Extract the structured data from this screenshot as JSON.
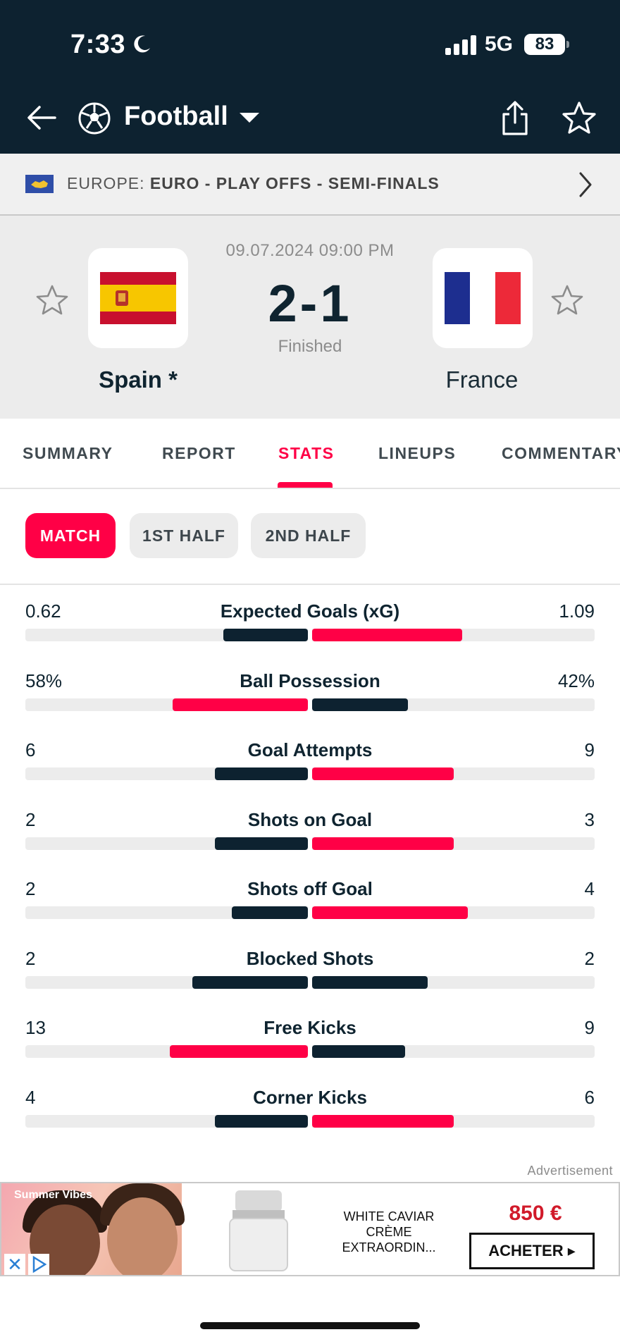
{
  "status_bar": {
    "time": "7:33",
    "network": "5G",
    "battery": "83"
  },
  "header": {
    "sport": "Football"
  },
  "league": {
    "region": "EUROPE:",
    "competition": "EURO - PLAY OFFS - SEMI-FINALS"
  },
  "match": {
    "date": "09.07.2024 09:00 PM",
    "score": "2-1",
    "status": "Finished",
    "home": {
      "name": "Spain *"
    },
    "away": {
      "name": "France"
    }
  },
  "tabs": [
    {
      "label": "SUMMARY",
      "active": false
    },
    {
      "label": "REPORT",
      "active": false
    },
    {
      "label": "STATS",
      "active": true
    },
    {
      "label": "LINEUPS",
      "active": false
    },
    {
      "label": "COMMENTARY",
      "active": false
    }
  ],
  "subtabs": [
    {
      "label": "MATCH",
      "active": true
    },
    {
      "label": "1ST HALF",
      "active": false
    },
    {
      "label": "2ND HALF",
      "active": false
    }
  ],
  "colors": {
    "dark": "#0d2230",
    "accent": "#ff0046",
    "track": "#ececec"
  },
  "stats": [
    {
      "label": "Expected Goals (xG)",
      "home": "0.62",
      "away": "1.09",
      "home_share": 0.3,
      "away_share": 0.53,
      "home_color": "dark",
      "away_color": "accent"
    },
    {
      "label": "Ball Possession",
      "home": "58%",
      "away": "42%",
      "home_share": 0.48,
      "away_share": 0.34,
      "home_color": "accent",
      "away_color": "dark"
    },
    {
      "label": "Goal Attempts",
      "home": "6",
      "away": "9",
      "home_share": 0.33,
      "away_share": 0.5,
      "home_color": "dark",
      "away_color": "accent"
    },
    {
      "label": "Shots on Goal",
      "home": "2",
      "away": "3",
      "home_share": 0.33,
      "away_share": 0.5,
      "home_color": "dark",
      "away_color": "accent"
    },
    {
      "label": "Shots off Goal",
      "home": "2",
      "away": "4",
      "home_share": 0.27,
      "away_share": 0.55,
      "home_color": "dark",
      "away_color": "accent"
    },
    {
      "label": "Blocked Shots",
      "home": "2",
      "away": "2",
      "home_share": 0.41,
      "away_share": 0.41,
      "home_color": "dark",
      "away_color": "dark"
    },
    {
      "label": "Free Kicks",
      "home": "13",
      "away": "9",
      "home_share": 0.49,
      "away_share": 0.33,
      "home_color": "accent",
      "away_color": "dark"
    },
    {
      "label": "Corner Kicks",
      "home": "4",
      "away": "6",
      "home_share": 0.33,
      "away_share": 0.5,
      "home_color": "dark",
      "away_color": "accent"
    }
  ],
  "ad": {
    "label": "Advertisement",
    "photo_title": "Summer Vibes",
    "text": "WHITE CAVIAR CRÈME EXTRAORDIN...",
    "price": "850 €",
    "cta": "ACHETER ▸"
  }
}
